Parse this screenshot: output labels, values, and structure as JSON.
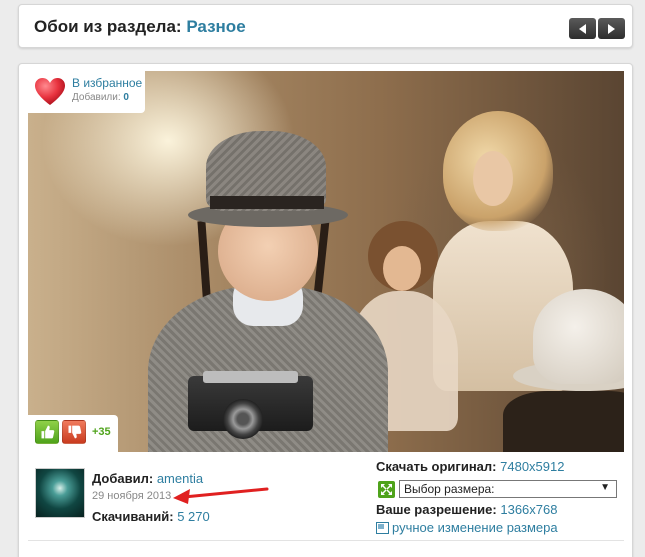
{
  "header": {
    "title_prefix": "Обои из раздела:",
    "category": "Разное",
    "prev_icon": "chevron-left-icon",
    "next_icon": "chevron-right-icon"
  },
  "favorite": {
    "label": "В избранное",
    "added_label": "Добавили:",
    "added_count": "0",
    "icon": "heart-icon",
    "color": "#e8333f"
  },
  "votes": {
    "like_icon": "thumbs-up-icon",
    "dislike_icon": "thumbs-down-icon",
    "score": "+35"
  },
  "uploader": {
    "added_by_label": "Добавил:",
    "username": "amentia",
    "date": "29 ноября 2013",
    "downloads_label": "Скачиваний:",
    "downloads_count": "5 270"
  },
  "download": {
    "original_label": "Скачать оригинал:",
    "original_size": "7480x5912",
    "size_select_value": "Выбор размера:",
    "your_resolution_label": "Ваше разрешение:",
    "your_resolution": "1366x768",
    "manual_resize": "ручное изменение размера"
  },
  "colors": {
    "accent": "#2e7ea0",
    "vote_positive": "#4fa31b",
    "annotation_arrow": "#e02020"
  }
}
